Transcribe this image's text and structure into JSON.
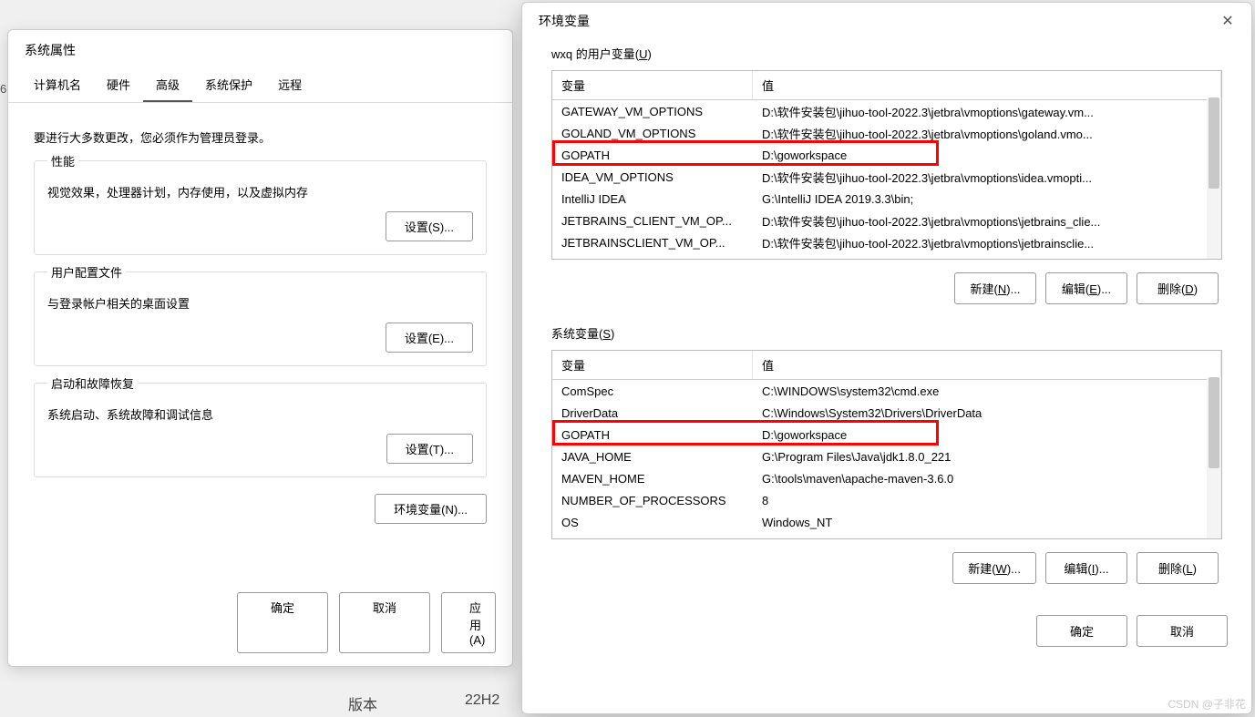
{
  "sysprops": {
    "title": "系统属性",
    "tabs": [
      "计算机名",
      "硬件",
      "高级",
      "系统保护",
      "远程"
    ],
    "active_tab": 2,
    "intro": "要进行大多数更改，您必须作为管理员登录。",
    "groups": [
      {
        "title": "性能",
        "desc": "视觉效果，处理器计划，内存使用，以及虚拟内存",
        "btn": "设置(S)..."
      },
      {
        "title": "用户配置文件",
        "desc": "与登录帐户相关的桌面设置",
        "btn": "设置(E)..."
      },
      {
        "title": "启动和故障恢复",
        "desc": "系统启动、系统故障和调试信息",
        "btn": "设置(T)..."
      }
    ],
    "env_btn": "环境变量(N)...",
    "footer": {
      "ok": "确定",
      "cancel": "取消",
      "apply": "应用(A)"
    }
  },
  "bg": {
    "six": "6",
    "version_label": "版本",
    "version_value": "22H2"
  },
  "env": {
    "title": "环境变量",
    "user_legend_prefix": "wxq 的用户变量(",
    "user_legend_u": "U",
    "user_legend_suffix": ")",
    "sys_legend_prefix": "系统变量(",
    "sys_legend_u": "S",
    "sys_legend_suffix": ")",
    "col_name": "变量",
    "col_value": "值",
    "user_vars": [
      {
        "name": "GATEWAY_VM_OPTIONS",
        "value": "D:\\软件安装包\\jihuo-tool-2022.3\\jetbra\\vmoptions\\gateway.vm..."
      },
      {
        "name": "GOLAND_VM_OPTIONS",
        "value": "D:\\软件安装包\\jihuo-tool-2022.3\\jetbra\\vmoptions\\goland.vmo..."
      },
      {
        "name": "GOPATH",
        "value": "D:\\goworkspace"
      },
      {
        "name": "IDEA_VM_OPTIONS",
        "value": "D:\\软件安装包\\jihuo-tool-2022.3\\jetbra\\vmoptions\\idea.vmopti..."
      },
      {
        "name": "IntelliJ IDEA",
        "value": "G:\\IntelliJ IDEA 2019.3.3\\bin;"
      },
      {
        "name": "JETBRAINS_CLIENT_VM_OP...",
        "value": "D:\\软件安装包\\jihuo-tool-2022.3\\jetbra\\vmoptions\\jetbrains_clie..."
      },
      {
        "name": "JETBRAINSCLIENT_VM_OP...",
        "value": "D:\\软件安装包\\jihuo-tool-2022.3\\jetbra\\vmoptions\\jetbrainsclie..."
      }
    ],
    "sys_vars": [
      {
        "name": "ComSpec",
        "value": "C:\\WINDOWS\\system32\\cmd.exe"
      },
      {
        "name": "DriverData",
        "value": "C:\\Windows\\System32\\Drivers\\DriverData"
      },
      {
        "name": "GOPATH",
        "value": "D:\\goworkspace"
      },
      {
        "name": "JAVA_HOME",
        "value": "G:\\Program Files\\Java\\jdk1.8.0_221"
      },
      {
        "name": "MAVEN_HOME",
        "value": "G:\\tools\\maven\\apache-maven-3.6.0"
      },
      {
        "name": "NUMBER_OF_PROCESSORS",
        "value": "8"
      },
      {
        "name": "OS",
        "value": "Windows_NT"
      }
    ],
    "buttons": {
      "new_u": "新建(N)...",
      "edit_u": "编辑(E)...",
      "del_u": "删除(D)",
      "new_s": "新建(W)...",
      "edit_s": "编辑(I)...",
      "del_s": "删除(L)",
      "ok": "确定",
      "cancel": "取消"
    }
  },
  "watermark": "CSDN @子非花"
}
